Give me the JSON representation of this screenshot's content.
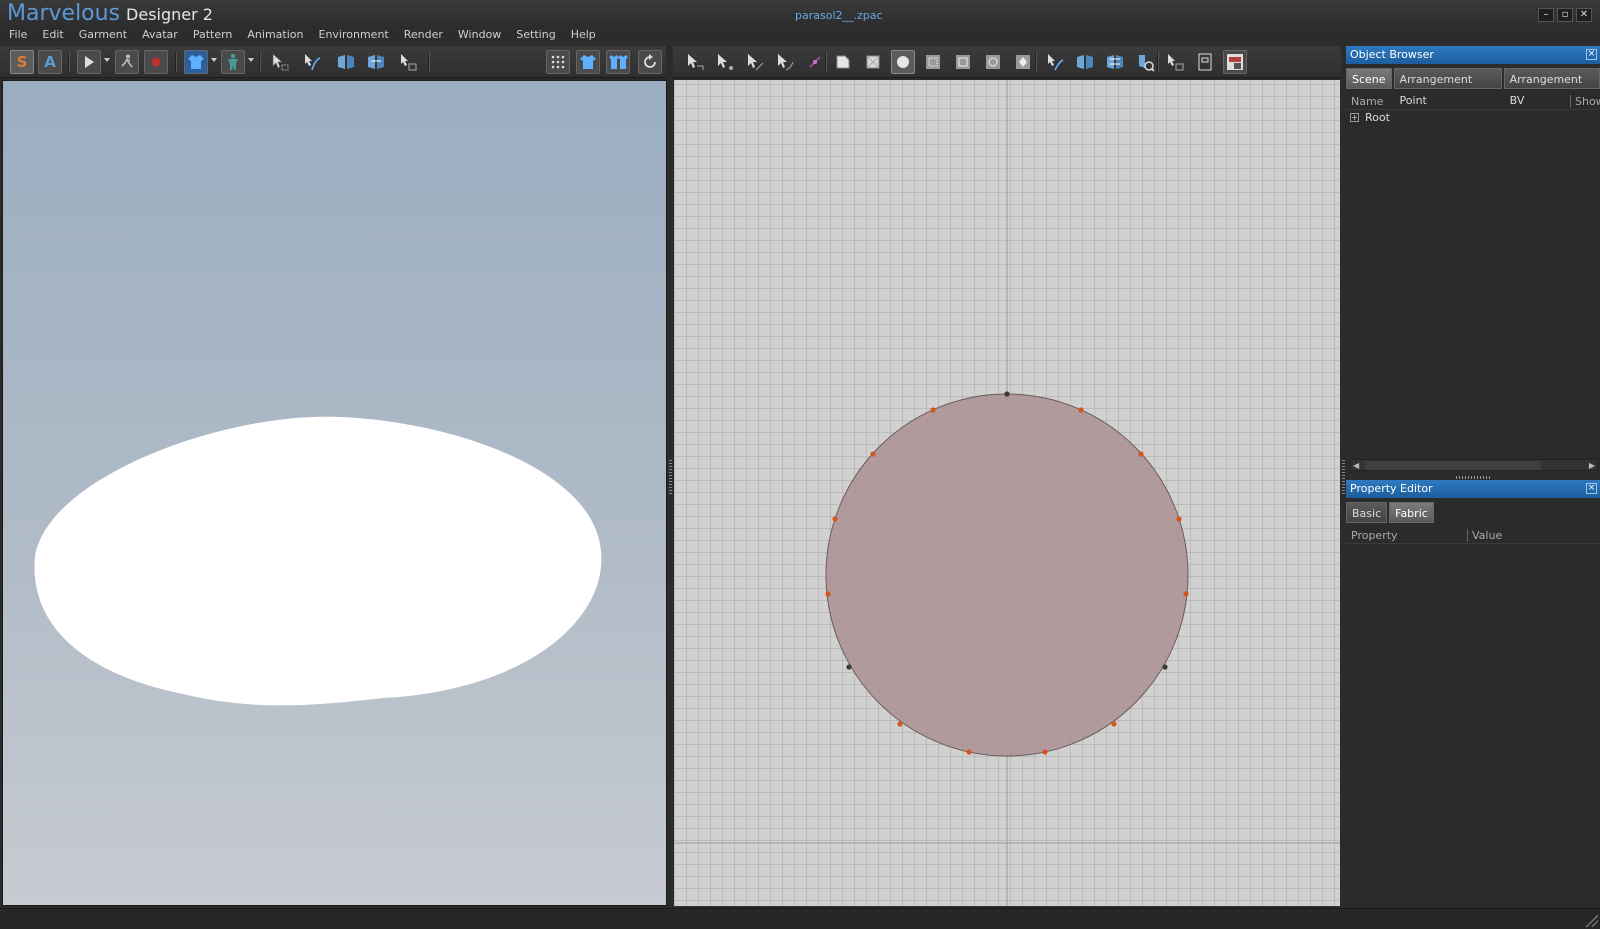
{
  "window": {
    "brand": "Marvelous",
    "product": "Designer 2",
    "document": "parasol2__.zpac",
    "controls": [
      "–",
      "▫",
      "✕"
    ]
  },
  "menu": [
    "File",
    "Edit",
    "Garment",
    "Avatar",
    "Pattern",
    "Animation",
    "Environment",
    "Render",
    "Window",
    "Setting",
    "Help"
  ],
  "toolbar_left": {
    "simulation_mode_label": "S",
    "animation_mode_label": "A",
    "icons": [
      "play-icon",
      "walk-icon",
      "record-icon",
      "garment-icon",
      "avatar-icon",
      "select-mesh-icon",
      "fold-icon",
      "tack-icon",
      "tack-multi-icon",
      "pin-box-icon",
      "particle-distance-icon",
      "show-garment-icon",
      "show-all-icon",
      "reset-icon"
    ]
  },
  "toolbar_right": {
    "icons": [
      "edit-pattern-icon",
      "edit-point-icon",
      "add-point-icon",
      "edit-curve-icon",
      "curve-point-icon",
      "polygon-icon",
      "rectangle-icon",
      "circle-icon",
      "internal-polygon-icon",
      "internal-rectangle-icon",
      "internal-circle-icon",
      "dart-icon",
      "segment-sewing-icon",
      "free-sewing-icon",
      "multi-sewing-icon",
      "check-sewing-icon",
      "arrange-icon",
      "text-icon",
      "fabric-texture-icon"
    ]
  },
  "colors": {
    "accent_blue": "#5b9bd5",
    "panel_header_blue": "#2f7ac0",
    "pattern_fill": "#ad9597",
    "pattern_stroke": "#6b5b5b",
    "point_orange": "#d4561f",
    "point_dark": "#3a3a3a"
  },
  "object_browser": {
    "title": "Object Browser",
    "tabs": [
      "Scene",
      "Arrangement Point",
      "Arrangement BV"
    ],
    "active_tab": "Scene",
    "columns": [
      "Name",
      "Show"
    ],
    "tree": [
      {
        "label": "Root",
        "expanded": false
      }
    ]
  },
  "property_editor": {
    "title": "Property Editor",
    "tabs": [
      "Basic",
      "Fabric"
    ],
    "active_tab": "Fabric",
    "columns": [
      "Property",
      "Value"
    ]
  }
}
